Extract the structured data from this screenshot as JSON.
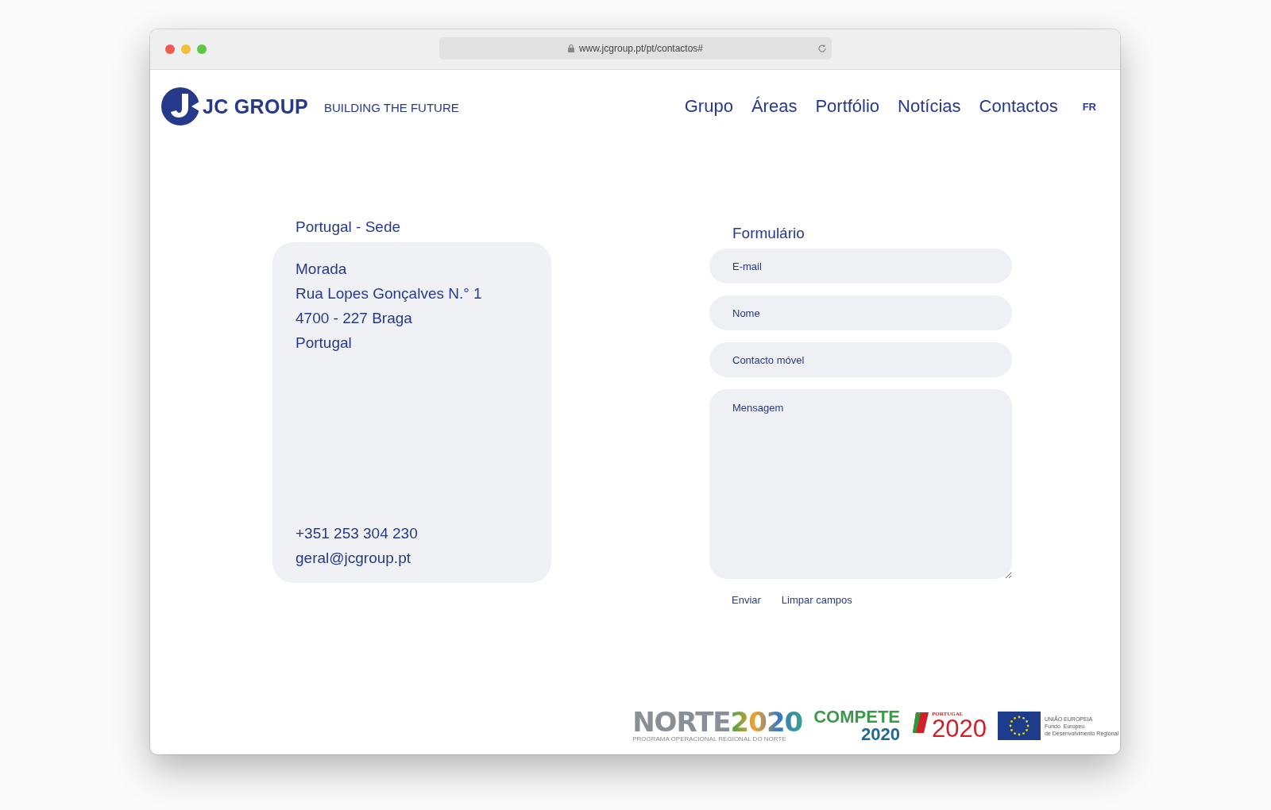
{
  "browser": {
    "url": "www.jcgroup.pt/pt/contactos#"
  },
  "header": {
    "logo": "JC GROUP",
    "tagline": "BUILDING THE FUTURE",
    "nav": [
      "Grupo",
      "Áreas",
      "Portfólio",
      "Notícias",
      "Contactos"
    ],
    "language": "FR"
  },
  "office": {
    "title": "Portugal - Sede",
    "address_lines": [
      "Morada",
      "Rua Lopes Gonçalves N.° 1",
      "4700 - 227 Braga",
      "Portugal"
    ],
    "phone": "+351 253 304 230",
    "email": "geral@jcgroup.pt"
  },
  "form": {
    "title": "Formulário",
    "fields": [
      {
        "kind": "input",
        "placeholder": "E-mail"
      },
      {
        "kind": "input",
        "placeholder": "Nome"
      },
      {
        "kind": "input",
        "placeholder": "Contacto móvel"
      },
      {
        "kind": "textarea",
        "placeholder": "Mensagem"
      }
    ],
    "buttons": [
      "Enviar",
      "Limpar campos"
    ]
  },
  "funding": [
    {
      "kind": "norte",
      "name": "NORTE",
      "year": "2020",
      "caption": "PROGRAMA OPERACIONAL REGIONAL DO NORTE"
    },
    {
      "kind": "compete",
      "name": "COMPETE",
      "year": "2020"
    },
    {
      "kind": "portugal",
      "name": "PORTUGAL",
      "year": "2020"
    },
    {
      "kind": "eu",
      "name": "UNIÃO EUROPEIA",
      "lines": [
        "Fundo  Europeu",
        "de Desenvolvimento Regional"
      ]
    }
  ]
}
